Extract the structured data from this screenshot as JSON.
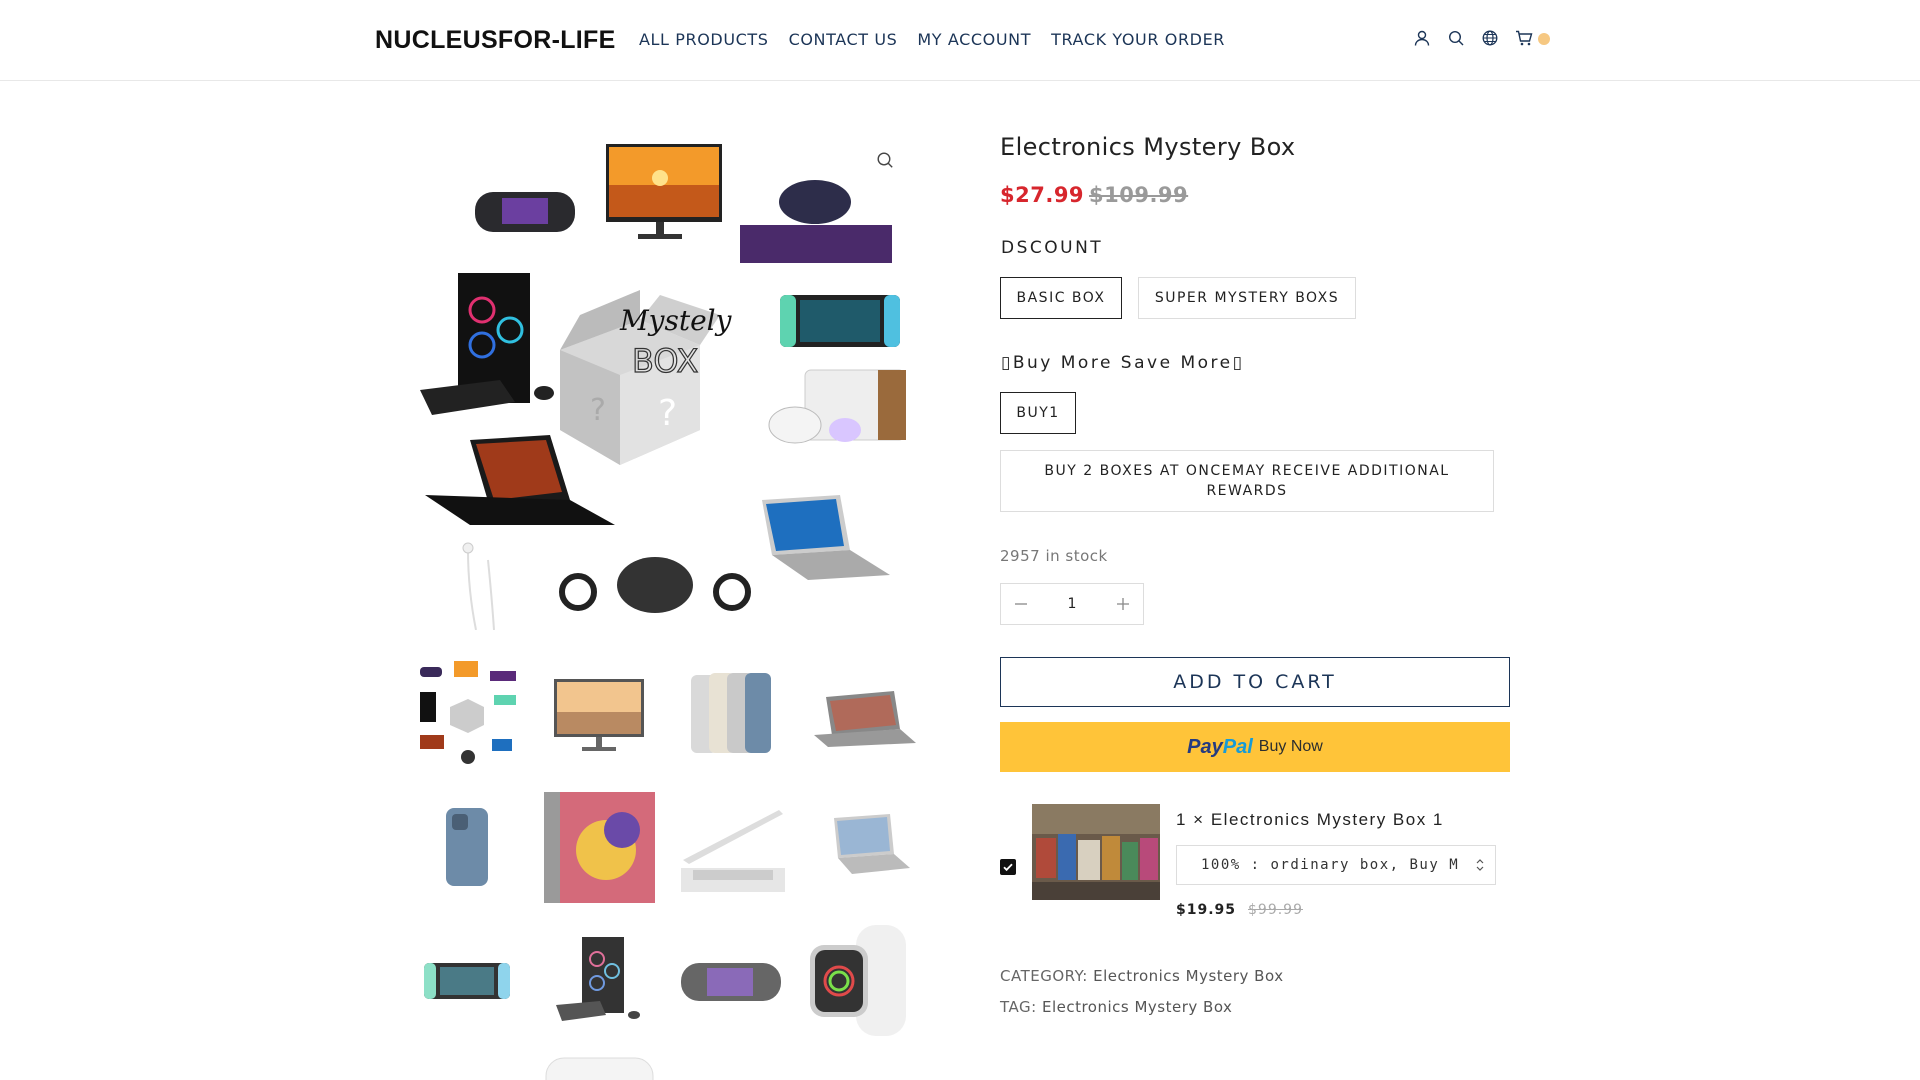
{
  "header": {
    "logo": "NUCLEUSFOR-LIFE",
    "nav": [
      "ALL PRODUCTS",
      "CONTACT US",
      "MY ACCOUNT",
      "TRACK YOUR ORDER"
    ],
    "icons": [
      "user-icon",
      "search-icon",
      "globe-icon",
      "cart-icon"
    ],
    "cart_badge_color": "#f6c882"
  },
  "product": {
    "title": "Electronics Mystery Box",
    "price": "$27.99",
    "old_price": "$109.99",
    "price_color": "#d7262d",
    "attribute1": {
      "label": "DSCOUNT",
      "options": [
        "BASIC BOX",
        "SUPER MYSTERY BOXS"
      ],
      "selected": "BASIC BOX"
    },
    "attribute2": {
      "label": "Buy More Save More",
      "options": [
        "BUY1",
        "BUY 2 BOXES AT ONCEMAY RECEIVE ADDITIONAL REWARDS"
      ],
      "selected": "BUY1"
    },
    "stock": "2957 in stock",
    "quantity": "1",
    "add_to_cart": "ADD TO CART",
    "paypal": {
      "logo_a": "Pay",
      "logo_b": "Pal",
      "text": "Buy Now",
      "color": "#ffc439"
    }
  },
  "bundle": {
    "title": "1 × Electronics Mystery Box 1",
    "select_value": "100% : ordinary box, Buy M",
    "price": "$19.95",
    "old_price": "$99.99",
    "checked": true
  },
  "meta": {
    "category_label": "CATEGORY:",
    "category_value": "Electronics Mystery Box",
    "tag_label": "TAG:",
    "tag_value": "Electronics Mystery Box"
  },
  "gallery": {
    "mystery_label_top": "Mystely",
    "mystery_label_bottom": "BOX",
    "thumbs": [
      "mystery-collage",
      "monitor",
      "iphones",
      "gaming-laptop",
      "iphone-back",
      "ipad",
      "macbook-slim",
      "acer-laptop",
      "nintendo-switch",
      "gaming-pc",
      "psp",
      "apple-watch",
      "airpods"
    ]
  }
}
